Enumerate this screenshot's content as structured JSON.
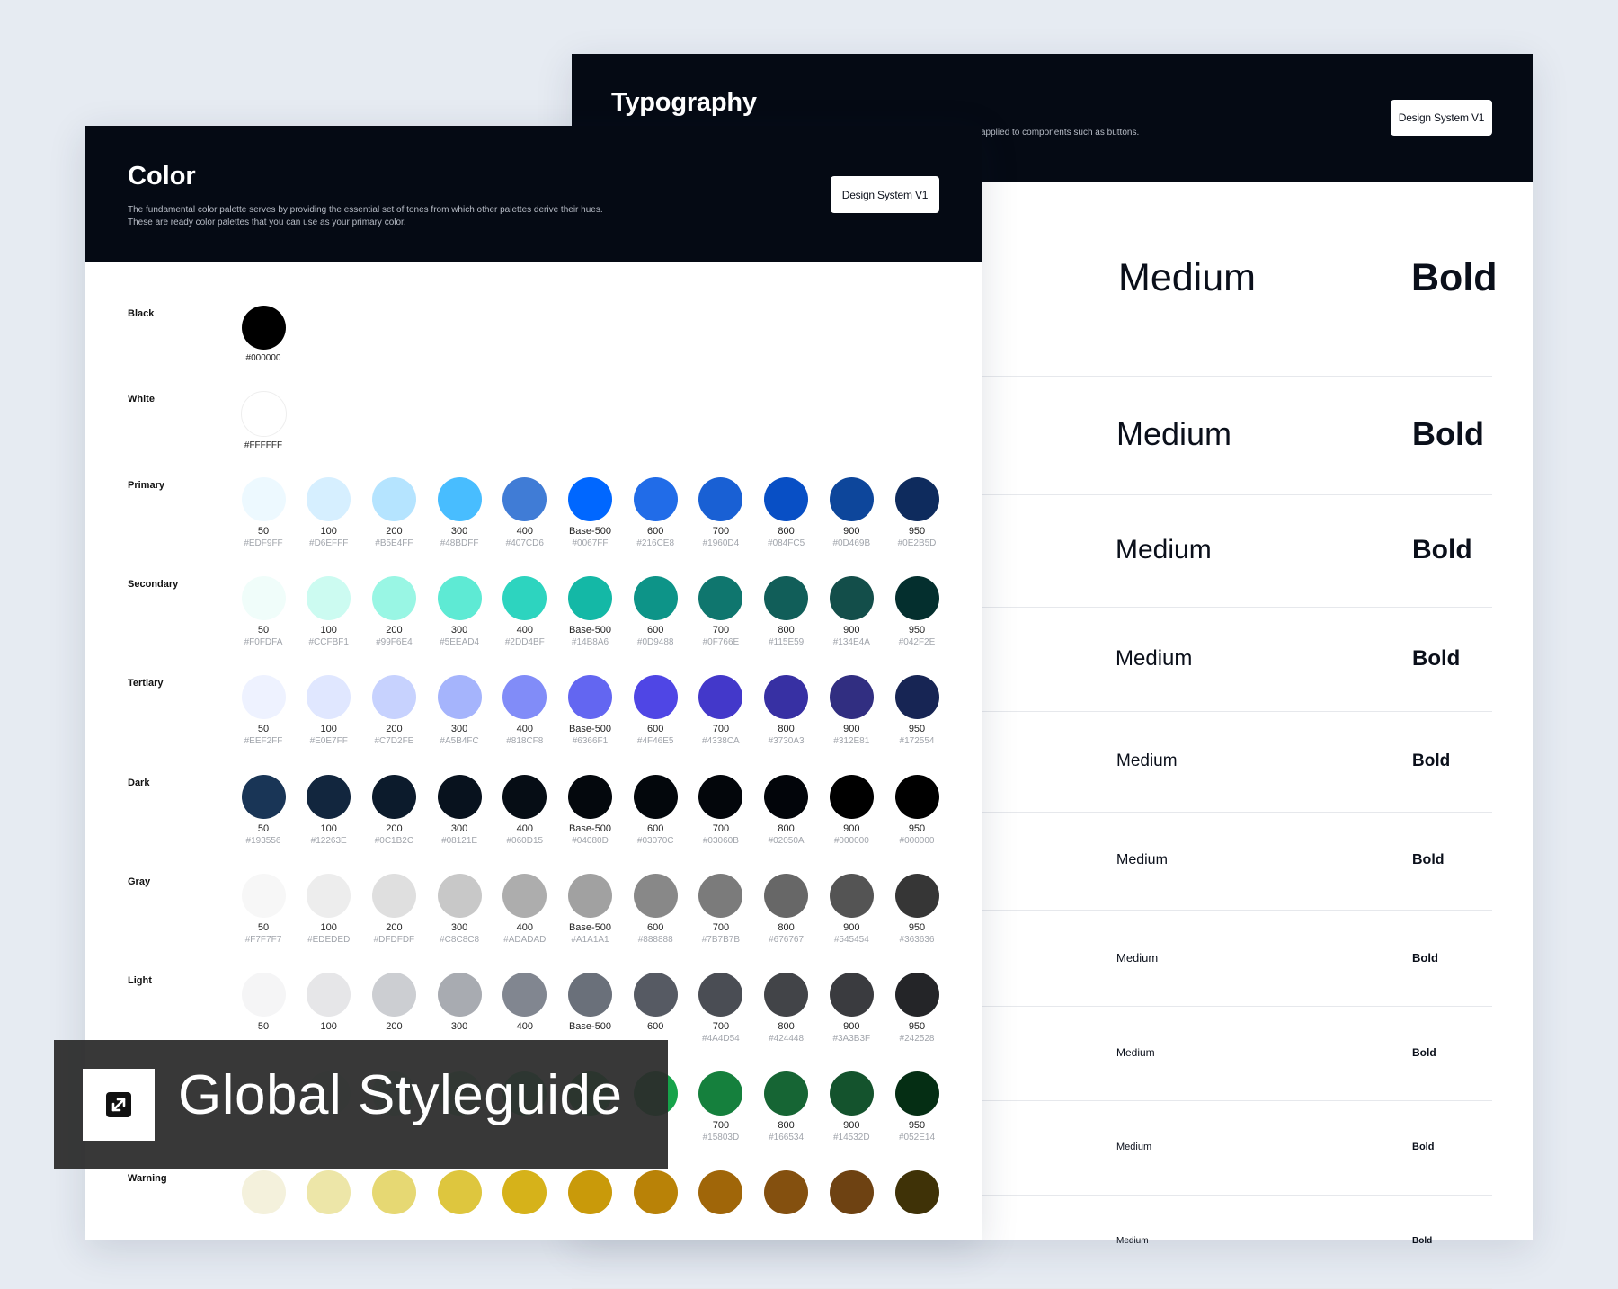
{
  "typography": {
    "title": "Typography",
    "description": "applied to components such as buttons.",
    "badge": "Design System V1",
    "rows": [
      {
        "medium": "Medium",
        "bold": "Bold"
      },
      {
        "medium": "Medium",
        "bold": "Bold"
      },
      {
        "medium": "Medium",
        "bold": "Bold"
      },
      {
        "medium": "Medium",
        "bold": "Bold"
      },
      {
        "medium": "Medium",
        "bold": "Bold"
      },
      {
        "medium": "Medium",
        "bold": "Bold"
      },
      {
        "medium": "Medium",
        "bold": "Bold"
      },
      {
        "medium": "Medium",
        "bold": "Bold"
      },
      {
        "medium": "Medium",
        "bold": "Bold"
      },
      {
        "medium": "Medium",
        "bold": "Bold"
      }
    ]
  },
  "color": {
    "title": "Color",
    "description_line1": "The fundamental color palette serves by providing the essential set of tones from which other palettes derive their hues.",
    "description_line2": "These are ready color palettes that you can use as your primary color.",
    "badge": "Design System V1",
    "singles": [
      {
        "label": "Black",
        "hex": "#000000"
      },
      {
        "label": "White",
        "hex": "#FFFFFF"
      }
    ],
    "groups": [
      {
        "label": "Primary",
        "swatches": [
          {
            "shade": "50",
            "hex": "#EDF9FF"
          },
          {
            "shade": "100",
            "hex": "#D6EFFF"
          },
          {
            "shade": "200",
            "hex": "#B5E4FF"
          },
          {
            "shade": "300",
            "hex": "#48BDFF"
          },
          {
            "shade": "400",
            "hex": "#407CD6"
          },
          {
            "shade": "Base-500",
            "hex": "#0067FF"
          },
          {
            "shade": "600",
            "hex": "#216CE8"
          },
          {
            "shade": "700",
            "hex": "#1960D4"
          },
          {
            "shade": "800",
            "hex": "#084FC5"
          },
          {
            "shade": "900",
            "hex": "#0D469B"
          },
          {
            "shade": "950",
            "hex": "#0E2B5D"
          }
        ]
      },
      {
        "label": "Secondary",
        "swatches": [
          {
            "shade": "50",
            "hex": "#F0FDFA"
          },
          {
            "shade": "100",
            "hex": "#CCFBF1"
          },
          {
            "shade": "200",
            "hex": "#99F6E4"
          },
          {
            "shade": "300",
            "hex": "#5EEAD4"
          },
          {
            "shade": "400",
            "hex": "#2DD4BF"
          },
          {
            "shade": "Base-500",
            "hex": "#14B8A6"
          },
          {
            "shade": "600",
            "hex": "#0D9488"
          },
          {
            "shade": "700",
            "hex": "#0F766E"
          },
          {
            "shade": "800",
            "hex": "#115E59"
          },
          {
            "shade": "900",
            "hex": "#134E4A"
          },
          {
            "shade": "950",
            "hex": "#042F2E"
          }
        ]
      },
      {
        "label": "Tertiary",
        "swatches": [
          {
            "shade": "50",
            "hex": "#EEF2FF"
          },
          {
            "shade": "100",
            "hex": "#E0E7FF"
          },
          {
            "shade": "200",
            "hex": "#C7D2FE"
          },
          {
            "shade": "300",
            "hex": "#A5B4FC"
          },
          {
            "shade": "400",
            "hex": "#818CF8"
          },
          {
            "shade": "Base-500",
            "hex": "#6366F1"
          },
          {
            "shade": "600",
            "hex": "#4F46E5"
          },
          {
            "shade": "700",
            "hex": "#4338CA"
          },
          {
            "shade": "800",
            "hex": "#3730A3"
          },
          {
            "shade": "900",
            "hex": "#312E81"
          },
          {
            "shade": "950",
            "hex": "#172554"
          }
        ]
      },
      {
        "label": "Dark",
        "swatches": [
          {
            "shade": "50",
            "hex": "#193556"
          },
          {
            "shade": "100",
            "hex": "#12263E"
          },
          {
            "shade": "200",
            "hex": "#0C1B2C"
          },
          {
            "shade": "300",
            "hex": "#08121E"
          },
          {
            "shade": "400",
            "hex": "#060D15"
          },
          {
            "shade": "Base-500",
            "hex": "#04080D"
          },
          {
            "shade": "600",
            "hex": "#03070C"
          },
          {
            "shade": "700",
            "hex": "#03060B"
          },
          {
            "shade": "800",
            "hex": "#02050A"
          },
          {
            "shade": "900",
            "hex": "#000000"
          },
          {
            "shade": "950",
            "hex": "#000000"
          }
        ]
      },
      {
        "label": "Gray",
        "swatches": [
          {
            "shade": "50",
            "hex": "#F7F7F7"
          },
          {
            "shade": "100",
            "hex": "#EDEDED"
          },
          {
            "shade": "200",
            "hex": "#DFDFDF"
          },
          {
            "shade": "300",
            "hex": "#C8C8C8"
          },
          {
            "shade": "400",
            "hex": "#ADADAD"
          },
          {
            "shade": "Base-500",
            "hex": "#A1A1A1"
          },
          {
            "shade": "600",
            "hex": "#888888"
          },
          {
            "shade": "700",
            "hex": "#7B7B7B"
          },
          {
            "shade": "800",
            "hex": "#676767"
          },
          {
            "shade": "900",
            "hex": "#545454"
          },
          {
            "shade": "950",
            "hex": "#363636"
          }
        ]
      },
      {
        "label": "Light",
        "swatches": [
          {
            "shade": "50",
            "hex": "",
            "color": "#F5F5F6"
          },
          {
            "shade": "100",
            "hex": "",
            "color": "#E6E6E8"
          },
          {
            "shade": "200",
            "hex": "",
            "color": "#CCCED2"
          },
          {
            "shade": "300",
            "hex": "",
            "color": "#A8ABB1"
          },
          {
            "shade": "400",
            "hex": "",
            "color": "#818690"
          },
          {
            "shade": "Base-500",
            "hex": "",
            "color": "#6A707A"
          },
          {
            "shade": "600",
            "hex": "",
            "color": "#565A63"
          },
          {
            "shade": "700",
            "hex": "#4A4D54"
          },
          {
            "shade": "800",
            "hex": "#424448"
          },
          {
            "shade": "900",
            "hex": "#3A3B3F"
          },
          {
            "shade": "950",
            "hex": "#242528"
          }
        ]
      },
      {
        "label": "",
        "swatches": [
          {
            "shade": "",
            "hex": "",
            "color": "#F0FDF4"
          },
          {
            "shade": "",
            "hex": "",
            "color": "#DCFCE7"
          },
          {
            "shade": "",
            "hex": "",
            "color": "#BBF7D0"
          },
          {
            "shade": "",
            "hex": "",
            "color": "#86EFAC"
          },
          {
            "shade": "",
            "hex": "",
            "color": "#4ADE80"
          },
          {
            "shade": "",
            "hex": "",
            "color": "#22C55E"
          },
          {
            "shade": "",
            "hex": "",
            "color": "#16A34A"
          },
          {
            "shade": "700",
            "hex": "#15803D"
          },
          {
            "shade": "800",
            "hex": "#166534"
          },
          {
            "shade": "900",
            "hex": "#14532D"
          },
          {
            "shade": "950",
            "hex": "#052E14"
          }
        ]
      },
      {
        "label": "Warning",
        "swatches": [
          {
            "shade": "",
            "hex": "",
            "color": "#F4F1DC"
          },
          {
            "shade": "",
            "hex": "",
            "color": "#EDE6A8"
          },
          {
            "shade": "",
            "hex": "",
            "color": "#E6D873"
          },
          {
            "shade": "",
            "hex": "",
            "color": "#DEC63E"
          },
          {
            "shade": "",
            "hex": "",
            "color": "#D6B21A"
          },
          {
            "shade": "",
            "hex": "",
            "color": "#C99A0A"
          },
          {
            "shade": "",
            "hex": "",
            "color": "#B98207"
          },
          {
            "shade": "",
            "hex": "",
            "color": "#A06609"
          },
          {
            "shade": "",
            "hex": "",
            "color": "#84500F"
          },
          {
            "shade": "",
            "hex": "",
            "color": "#6E4212"
          },
          {
            "shade": "",
            "hex": "",
            "color": "#3F3207"
          }
        ]
      }
    ]
  },
  "banner": {
    "text": "Global Styleguide",
    "icon": "expand-arrows-icon"
  }
}
